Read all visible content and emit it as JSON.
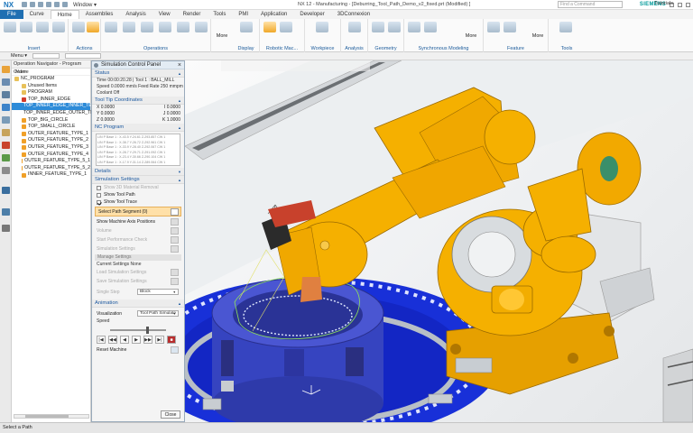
{
  "titlebar": {
    "app": "NX",
    "window_menu": "Window",
    "title": "NX 12 - Manufacturing - [Deburring_Tool_Path_Demo_v2_fixed.prt (Modified) ]",
    "brand": "SIEMENS"
  },
  "ribbon_tabs": [
    "File",
    "Curve",
    "Home",
    "Assemblies",
    "Analysis",
    "View",
    "Render",
    "Tools",
    "PMI",
    "Application",
    "Developer",
    "3DConnexion"
  ],
  "active_tab": "Home",
  "command_search_placeholder": "Find a Command",
  "tutorials": "Tutorials",
  "ribbon_groups": [
    "Insert",
    "Actions",
    "Operations",
    "Display",
    "Robotic Mac...",
    "Workpiece",
    "Analysis",
    "Geometry",
    "Synchronous Modeling",
    "Feature",
    "Tools"
  ],
  "more_label": "More",
  "selbar": {
    "menu": "Menu"
  },
  "navigator": {
    "header": "Operation Navigator - Program Order",
    "column": "Name",
    "items": [
      {
        "label": "NC_PROGRAM",
        "indent": 0,
        "icon": "folder-icon"
      },
      {
        "label": "Unused Items",
        "indent": 1,
        "icon": "folder-icon"
      },
      {
        "label": "PROGRAM",
        "indent": 1,
        "icon": "folder-icon"
      },
      {
        "label": "TOP_INNER_EDGE",
        "indent": 1,
        "icon": "error-operation-icon"
      },
      {
        "label": "TOP_INNER_EDGE_INNER_TE",
        "indent": 1,
        "icon": "operation-icon",
        "selected": true
      },
      {
        "label": "TOP_INNER_EDGE_OUTER_TE",
        "indent": 1,
        "icon": "operation-icon"
      },
      {
        "label": "TOP_BIG_CIRCLE",
        "indent": 1,
        "icon": "operation-icon"
      },
      {
        "label": "TOP_SMALL_CIRCLE",
        "indent": 1,
        "icon": "operation-icon"
      },
      {
        "label": "OUTER_FEATURE_TYPE_1",
        "indent": 1,
        "icon": "operation-icon"
      },
      {
        "label": "OUTER_FEATURE_TYPE_2",
        "indent": 1,
        "icon": "operation-icon"
      },
      {
        "label": "OUTER_FEATURE_TYPE_3",
        "indent": 1,
        "icon": "operation-icon"
      },
      {
        "label": "OUTER_FEATURE_TYPE_4",
        "indent": 1,
        "icon": "operation-icon"
      },
      {
        "label": "OUTER_FEATURE_TYPE_5_1",
        "indent": 1,
        "icon": "operation-icon"
      },
      {
        "label": "OUTER_FEATURE_TYPE_5_2",
        "indent": 1,
        "icon": "operation-icon"
      },
      {
        "label": "INNER_FEATURE_TYPE_1",
        "indent": 1,
        "icon": "operation-icon"
      }
    ]
  },
  "dialog": {
    "title": "Simulation Control Panel",
    "status": {
      "header": "Status",
      "time": "Time 00:00:20.28 | Tool 1 : BALL_MILL",
      "speed": "Speed 0.0000 mm/s    Feed Rate 250 mmpm",
      "coolant": "Coolant Off"
    },
    "coords": {
      "header": "Tool Tip Coordinates",
      "rows": [
        {
          "l": "X 0.0000",
          "r": "I 0.0000"
        },
        {
          "l": "Y 0.0000",
          "r": "J 0.0000"
        },
        {
          "l": "Z 0.0000",
          "r": "K 1.0000"
        }
      ]
    },
    "nc": {
      "header": "NC Program",
      "lines": [
        "LIN P Base 1 : X-43.5 Y-24.61 Z-293.857 CW 1",
        "LIN P Base 1 : X-38.7 Y-26.72 Z-292.961 CW 1",
        "LIN P Base 1 : X-33.9 Y-28.40 Z-292.067 CW 1",
        "LIN P Base 1 : X-28.7 Y-29.71 Z-291.092 CW 1",
        "LIN P Base 1 : X-23.4 Y-30.66 Z-290.104 CW 1",
        "LIN P Base 1 : X-17.9 Y-31.14 Z-289.064 CW 1"
      ]
    },
    "details_header": "Details",
    "settings": {
      "header": "Simulation Settings",
      "show_3d": "Show 3D Material Removal",
      "show_tool_path": "Show Tool Path",
      "show_tool_trace": "Show Tool Trace",
      "select_path": "Select Path Segment (0)",
      "show_machine": "Show Machine Axis Positions",
      "volume": "Volume",
      "start_perf": "Start Performance Check",
      "sim_settings": "Simulation Settings",
      "manage": "Manage Settings",
      "current": "Current Settings None",
      "load": "Load Simulation Settings",
      "save": "Save Simulation Settings",
      "single_step": "Single Step",
      "single_step_value": "Block"
    },
    "animation": {
      "header": "Animation",
      "visualization": "Visualization",
      "visualization_value": "Tool Path Simulate",
      "speed": "Speed",
      "speed_level": 0.62,
      "buttons": [
        "|◀",
        "◀◀",
        "◀",
        "▶",
        "▶▶",
        "▶|",
        "■"
      ],
      "reset": "Reset Machine"
    },
    "close": "Close"
  },
  "status_bar": "Select a Path",
  "colors": {
    "accent": "#1f6fb2",
    "robot": "#f5a800",
    "fixture": "#3140c8",
    "table": "#1133e0",
    "selection": "#2d8bd8"
  }
}
